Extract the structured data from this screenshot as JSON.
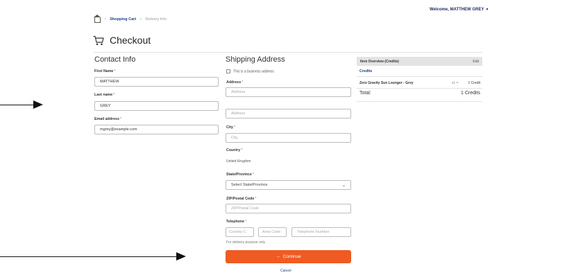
{
  "header": {
    "welcome": "Welcome, MATTHEW GREY",
    "breadcrumb": {
      "shopping_cart": "Shopping Cart",
      "separator": ">",
      "delivery_info": "Delivery Info"
    },
    "title": "Checkout",
    "icons": {
      "home": "home-icon",
      "cart": "cart-icon",
      "caret": "caret-down-icon",
      "arrow": "arrow-right-icon"
    }
  },
  "contact": {
    "heading": "Contact Info",
    "first_name_label": "First Name",
    "first_name_value": "MATTHEW",
    "last_name_label": "Last name",
    "last_name_value": "GREY",
    "email_label": "Email address",
    "email_value": "mgrey@example.com",
    "required_mark": "*"
  },
  "shipping": {
    "heading": "Shipping Address",
    "business_checkbox_label": "This is a business address",
    "address_label": "Address",
    "address1_placeholder": "Address",
    "address2_placeholder": "Address",
    "city_label": "City",
    "city_placeholder": "City",
    "country_label": "Country",
    "country_value": "United Kingdom",
    "state_label": "State/Province",
    "state_selected": "Select State/Province",
    "zip_label": "ZIP/Postal Code",
    "zip_placeholder": "ZIP/Postal Code",
    "telephone_label": "Telephone",
    "country_code_placeholder": "Country C",
    "area_code_placeholder": "Area Code",
    "phone_placeholder": "Telephone Number",
    "phone_note": "For delivery purpose only",
    "continue_label": "Continue",
    "cancel_label": "Cancel"
  },
  "order": {
    "overview_label": "Item Overview (Credits)",
    "edit_label": "Edit",
    "credits_heading": "Credits",
    "item_name": "Zero Gravity Sun Lounger - Grey",
    "item_qty": "x1 =",
    "item_credits": "1 Credit",
    "total_label": "Total:",
    "total_value": "1 Credits"
  },
  "colors": {
    "accent": "#ef5b22",
    "link": "#1f3b8a",
    "panel_header": "#e3e3e3"
  }
}
